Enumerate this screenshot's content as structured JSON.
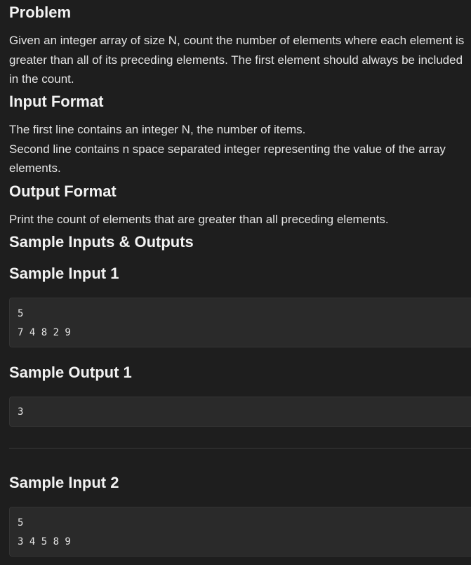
{
  "problem": {
    "title": "Problem",
    "text": "Given an integer array of size N, count the number of elements where each element is greater than all of its preceding elements. The first element should always be included in the count."
  },
  "input_format": {
    "title": "Input Format",
    "line1": "The first line contains an integer N, the number of items.",
    "line2": "Second line contains n space separated integer representing the value of the array elements."
  },
  "output_format": {
    "title": "Output Format",
    "text": "Print the count of elements that are greater than all preceding elements."
  },
  "samples": {
    "title": "Sample Inputs & Outputs",
    "input1": {
      "title": "Sample Input 1",
      "lines": [
        "5",
        "7 4 8 2 9"
      ]
    },
    "output1": {
      "title": "Sample Output 1",
      "lines": [
        "3"
      ]
    },
    "input2": {
      "title": "Sample Input 2",
      "lines": [
        "5",
        "3 4 5 8 9"
      ]
    }
  }
}
